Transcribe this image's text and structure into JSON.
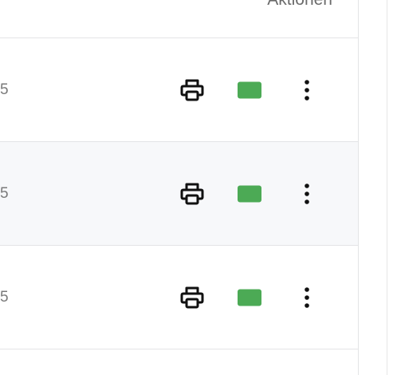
{
  "table": {
    "header": {
      "actions_label": "Aktionen"
    },
    "rows": [
      {
        "value": "5",
        "print_icon": "printer-icon",
        "status_color": "#4caa55",
        "menu_icon": "more-vertical-icon"
      },
      {
        "value": "5",
        "print_icon": "printer-icon",
        "status_color": "#4caa55",
        "menu_icon": "more-vertical-icon"
      },
      {
        "value": "5",
        "print_icon": "printer-icon",
        "status_color": "#4caa55",
        "menu_icon": "more-vertical-icon"
      }
    ]
  },
  "colors": {
    "status_green": "#4caa55",
    "row_alt_background": "#f7f8fa",
    "border": "#e3e4e6"
  }
}
